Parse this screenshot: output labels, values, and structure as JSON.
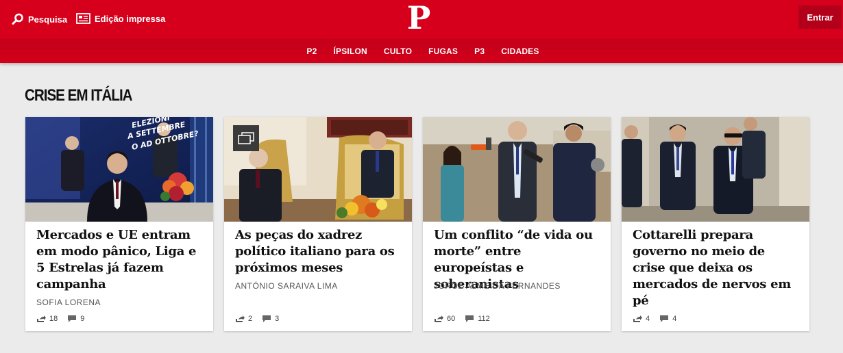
{
  "header": {
    "search_label": "Pesquisa",
    "print_label": "Edição impressa",
    "logo": "P",
    "login_label": "Entrar"
  },
  "nav": [
    "P2",
    "ÍPSILON",
    "CULTO",
    "FUGAS",
    "P3",
    "CIDADES"
  ],
  "section": {
    "title": "CRISE EM ITÁLIA"
  },
  "articles": [
    {
      "headline": "Mercados e UE entram em modo pânico, Liga e 5 Estrelas já fazem campanha",
      "author": "SOFIA LORENA",
      "shares": "18",
      "comments": "9",
      "image_caption": "ELEZIONI A SETTEMBRE O AD OTTOBRE?"
    },
    {
      "headline": "As peças do xadrez político italiano para os próximos meses",
      "author": "ANTÓNIO SARAIVA LIMA",
      "shares": "2",
      "comments": "3"
    },
    {
      "headline": "Um conflito “de vida ou morte” entre europeístas e soberanistas",
      "author": "JORGE ALMEIDA FERNANDES",
      "shares": "60",
      "comments": "112"
    },
    {
      "headline": "Cottarelli prepara governo no meio de crise que deixa os mercados de nervos em pé",
      "author": "",
      "shares": "4",
      "comments": "4"
    }
  ],
  "colors": {
    "brand_red": "#d6001c",
    "login_bg": "#b3001a",
    "page_bg": "#ebebeb"
  }
}
